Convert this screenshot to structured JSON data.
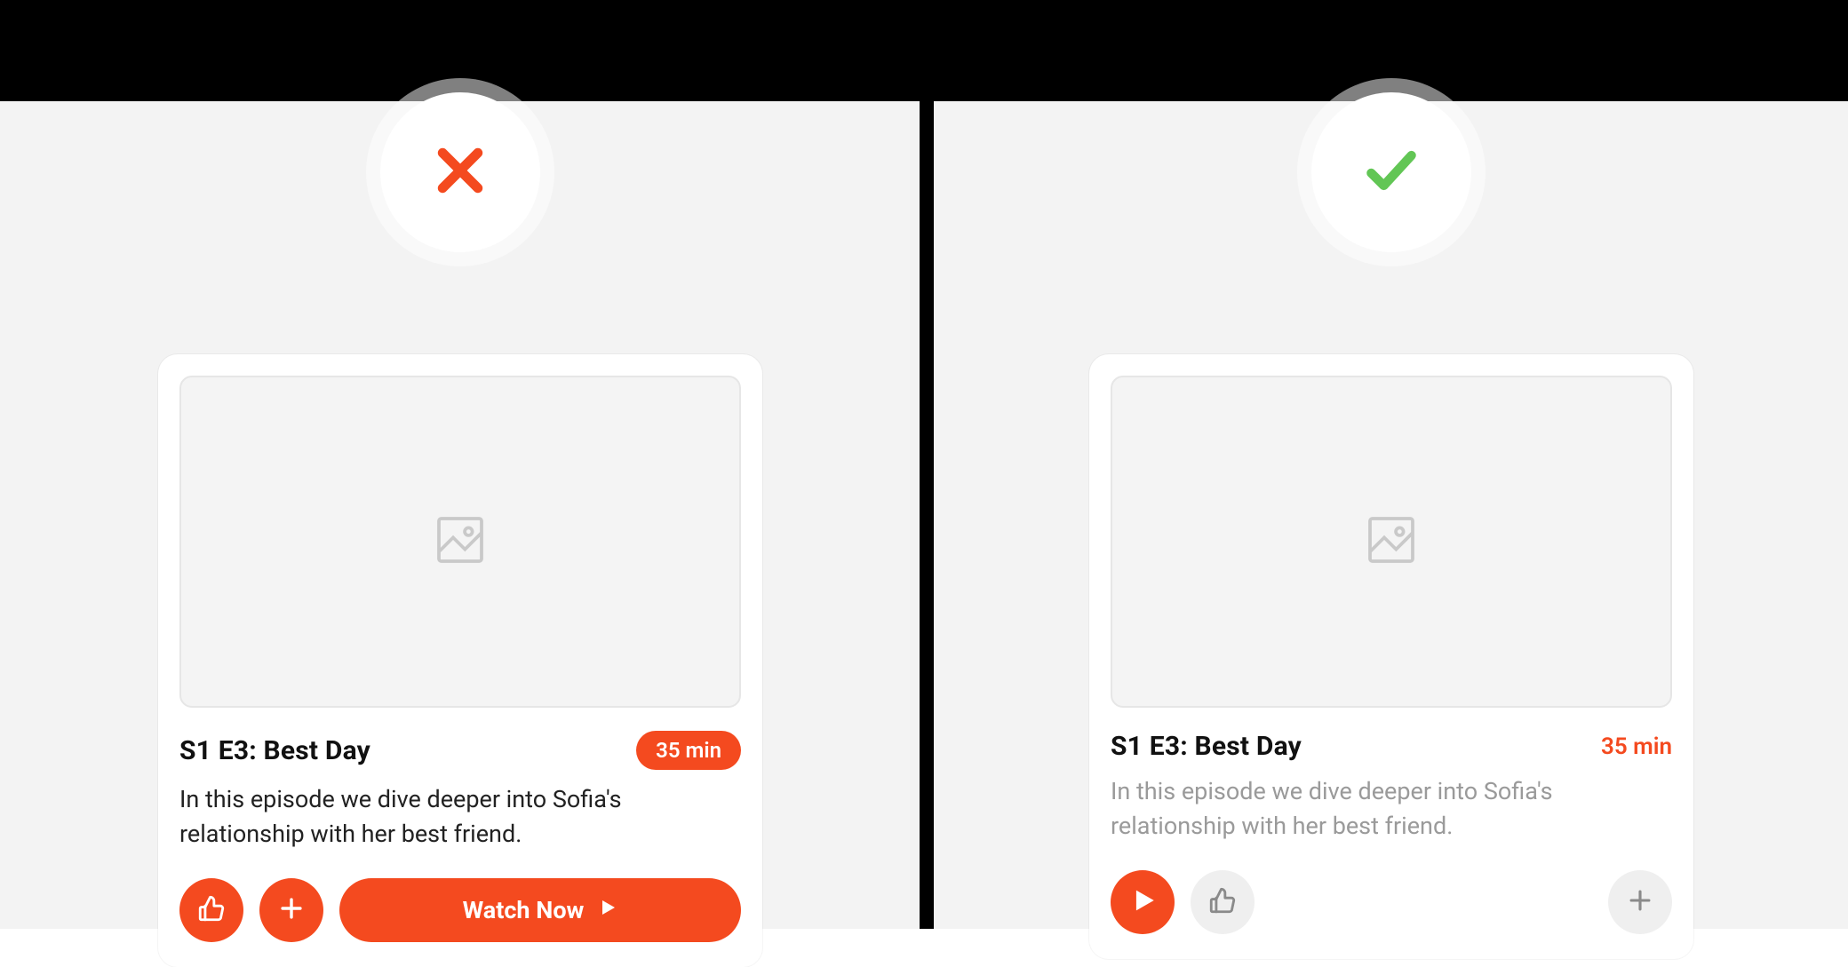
{
  "colors": {
    "accent": "#f44a1f",
    "success": "#62c655",
    "panel_bg": "#f3f3f3",
    "card_bg": "#ffffff",
    "thumb_bg": "#f4f4f4",
    "muted_text": "#9a9a9a"
  },
  "badges": {
    "left": {
      "icon": "cross-icon",
      "meaning": "incorrect"
    },
    "right": {
      "icon": "check-icon",
      "meaning": "correct"
    }
  },
  "left_card": {
    "title": "S1 E3: Best Day",
    "duration": "35 min",
    "description": "In this episode we dive deeper into Sofia's relationship with her best friend.",
    "actions": {
      "like_icon": "thumbs-up-icon",
      "add_icon": "plus-icon",
      "watch_label": "Watch Now",
      "watch_icon": "play-icon"
    }
  },
  "right_card": {
    "title": "S1 E3: Best Day",
    "duration": "35 min",
    "description": "In this episode we dive deeper into Sofia's relationship with her best friend.",
    "actions": {
      "play_icon": "play-icon",
      "like_icon": "thumbs-up-icon",
      "add_icon": "plus-icon"
    }
  }
}
